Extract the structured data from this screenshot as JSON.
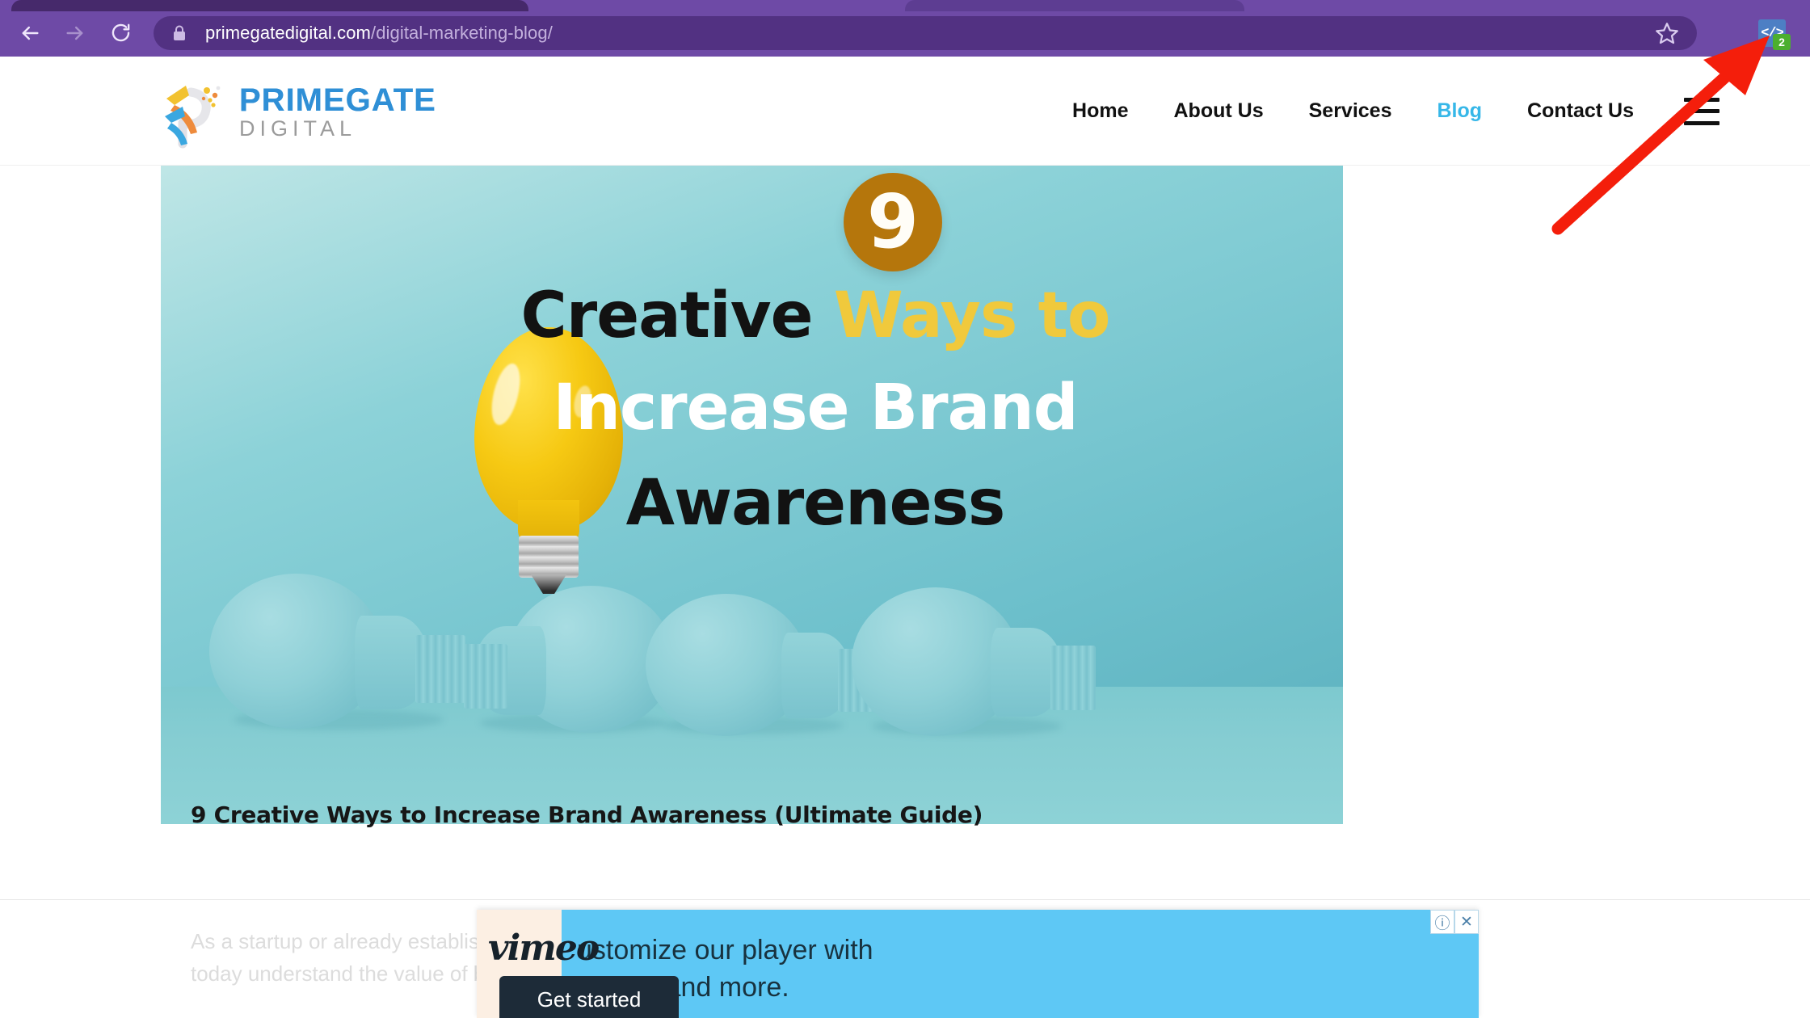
{
  "browser": {
    "back_icon": "back-arrow-icon",
    "forward_icon": "forward-arrow-icon",
    "reload_icon": "reload-icon",
    "lock_icon": "lock-icon",
    "url_domain": "primegatedigital.com",
    "url_path": "/digital-marketing-blog/",
    "bookmark_icon": "star-icon",
    "extension_icon_glyph": "</>",
    "extension_badge_count": "2",
    "colors": {
      "chrome_bg": "#6e4aa6",
      "omnibox_bg": "#523182",
      "active_tab": "#46296b",
      "extension_badge": "#4caf2f"
    }
  },
  "site_header": {
    "logo_primary": "PRIMEGATE",
    "logo_secondary": "DIGITAL",
    "nav": [
      {
        "label": "Home",
        "active": false
      },
      {
        "label": "About Us",
        "active": false
      },
      {
        "label": "Services",
        "active": false
      },
      {
        "label": "Blog",
        "active": true
      },
      {
        "label": "Contact Us",
        "active": false
      }
    ],
    "menu_icon": "hamburger-menu-icon",
    "accent_color": "#36b7e8"
  },
  "hero": {
    "badge_number": "9",
    "line1_black": "Creative ",
    "line1_yellow": "Ways to",
    "line2": "Increase Brand",
    "line3": "Awareness",
    "badge_color": "#b5760c",
    "yellow_color": "#f0c93c"
  },
  "article": {
    "title": "9 Creative Ways to Increase Brand Awareness (Ultimate Guide)",
    "body": "As a startup or already established business, you need to know that all the successful brands today understand the value of brand awareness."
  },
  "ad": {
    "brand": "vimeo",
    "copy": "ustomize our player with\ncolors, and more.",
    "cta_label": "Get started",
    "info_icon": "ⓘ",
    "close_icon": "✕",
    "bg_color": "#5ec8f5"
  },
  "annotation": {
    "type": "arrow",
    "color": "#f41e0b",
    "points_to": "extension-icon"
  }
}
